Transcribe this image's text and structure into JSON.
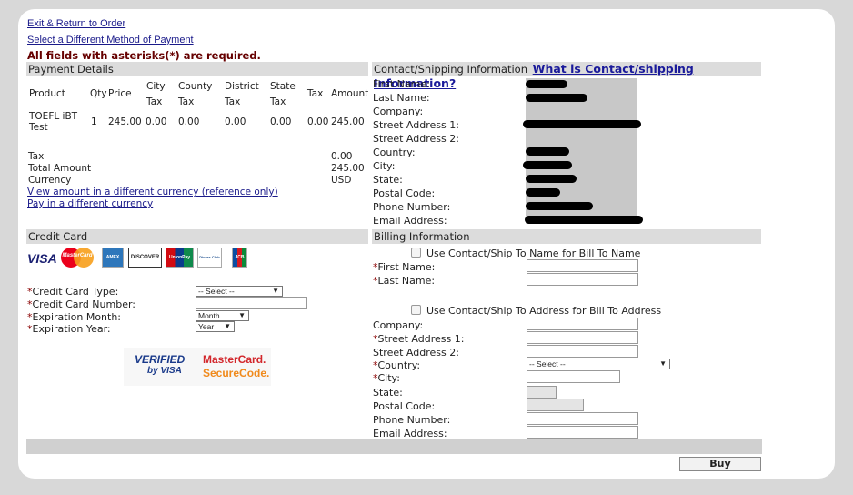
{
  "nav": {
    "exit_link": "Exit & Return to Order",
    "method_link": "Select a Different Method of Payment",
    "required_note": "All fields with asterisks(*) are required."
  },
  "payment": {
    "title": "Payment Details",
    "columns": {
      "product": "Product",
      "qty": "Qty",
      "price": "Price",
      "city_tax_1": "City",
      "city_tax_2": "Tax",
      "county_tax_1": "County",
      "county_tax_2": "Tax",
      "district_tax_1": "District",
      "district_tax_2": "Tax",
      "state_tax_1": "State",
      "state_tax_2": "Tax",
      "tax": "Tax",
      "amount": "Amount"
    },
    "row": {
      "product_1": "TOEFL iBT",
      "product_2": "Test",
      "qty": "1",
      "price": "245.00",
      "city_tax": "0.00",
      "county_tax": "0.00",
      "district_tax": "0.00",
      "state_tax": "0.00",
      "tax": "0.00",
      "amount": "245.00"
    },
    "totals": {
      "tax_label": "Tax",
      "tax_value": "0.00",
      "total_label": "Total Amount",
      "total_value": "245.00",
      "currency_label": "Currency",
      "currency_value": "USD"
    },
    "view_currency_link": "View amount in a different currency (reference only)",
    "pay_currency_link": "Pay in a different currency"
  },
  "contact": {
    "title": "Contact/Shipping Information",
    "help_link": "What is Contact/shipping Information?",
    "fields": [
      "First Name:",
      "Last Name:",
      "Company:",
      "Street Address 1:",
      "Street Address 2:",
      "Country:",
      "City:",
      "State:",
      "Postal Code:",
      "Phone Number:",
      "Email Address:"
    ]
  },
  "credit": {
    "title": "Credit Card",
    "logos": {
      "visa": "VISA",
      "mastercard": "MasterCard",
      "amex": "AMEX",
      "discover": "DISCOVER",
      "unionpay": "UnionPay",
      "diners": "Diners Club",
      "jcb": "JCB"
    },
    "card_type_label": "Credit Card Type:",
    "card_type_value": "-- Select --",
    "card_number_label": "Credit Card Number:",
    "exp_month_label": "Expiration Month:",
    "exp_month_value": "Month",
    "exp_year_label": "Expiration Year:",
    "exp_year_value": "Year",
    "asterisk": "*",
    "verified_1": "VERIFIED",
    "verified_2": "by VISA",
    "securecode_1": "MasterCard.",
    "securecode_2": "SecureCode."
  },
  "billing": {
    "title": "Billing Information",
    "use_name_label": "Use Contact/Ship To Name for Bill To Name",
    "first_name_label": "First Name:",
    "last_name_label": "Last Name:",
    "use_address_label": "Use Contact/Ship To Address for Bill To Address",
    "company_label": "Company:",
    "street1_label": "Street Address 1:",
    "street2_label": "Street Address 2:",
    "country_label": "Country:",
    "country_value": "-- Select --",
    "city_label": "City:",
    "state_label": "State:",
    "postal_label": "Postal Code:",
    "phone_label": "Phone Number:",
    "email_label": "Email Address:",
    "asterisk": "*"
  },
  "actions": {
    "buy_label": "Buy"
  },
  "colors": {
    "section_bar": "#dcdcdc",
    "link": "#1a1a8a",
    "required_text": "#660000",
    "asterisk": "#8a0000"
  }
}
